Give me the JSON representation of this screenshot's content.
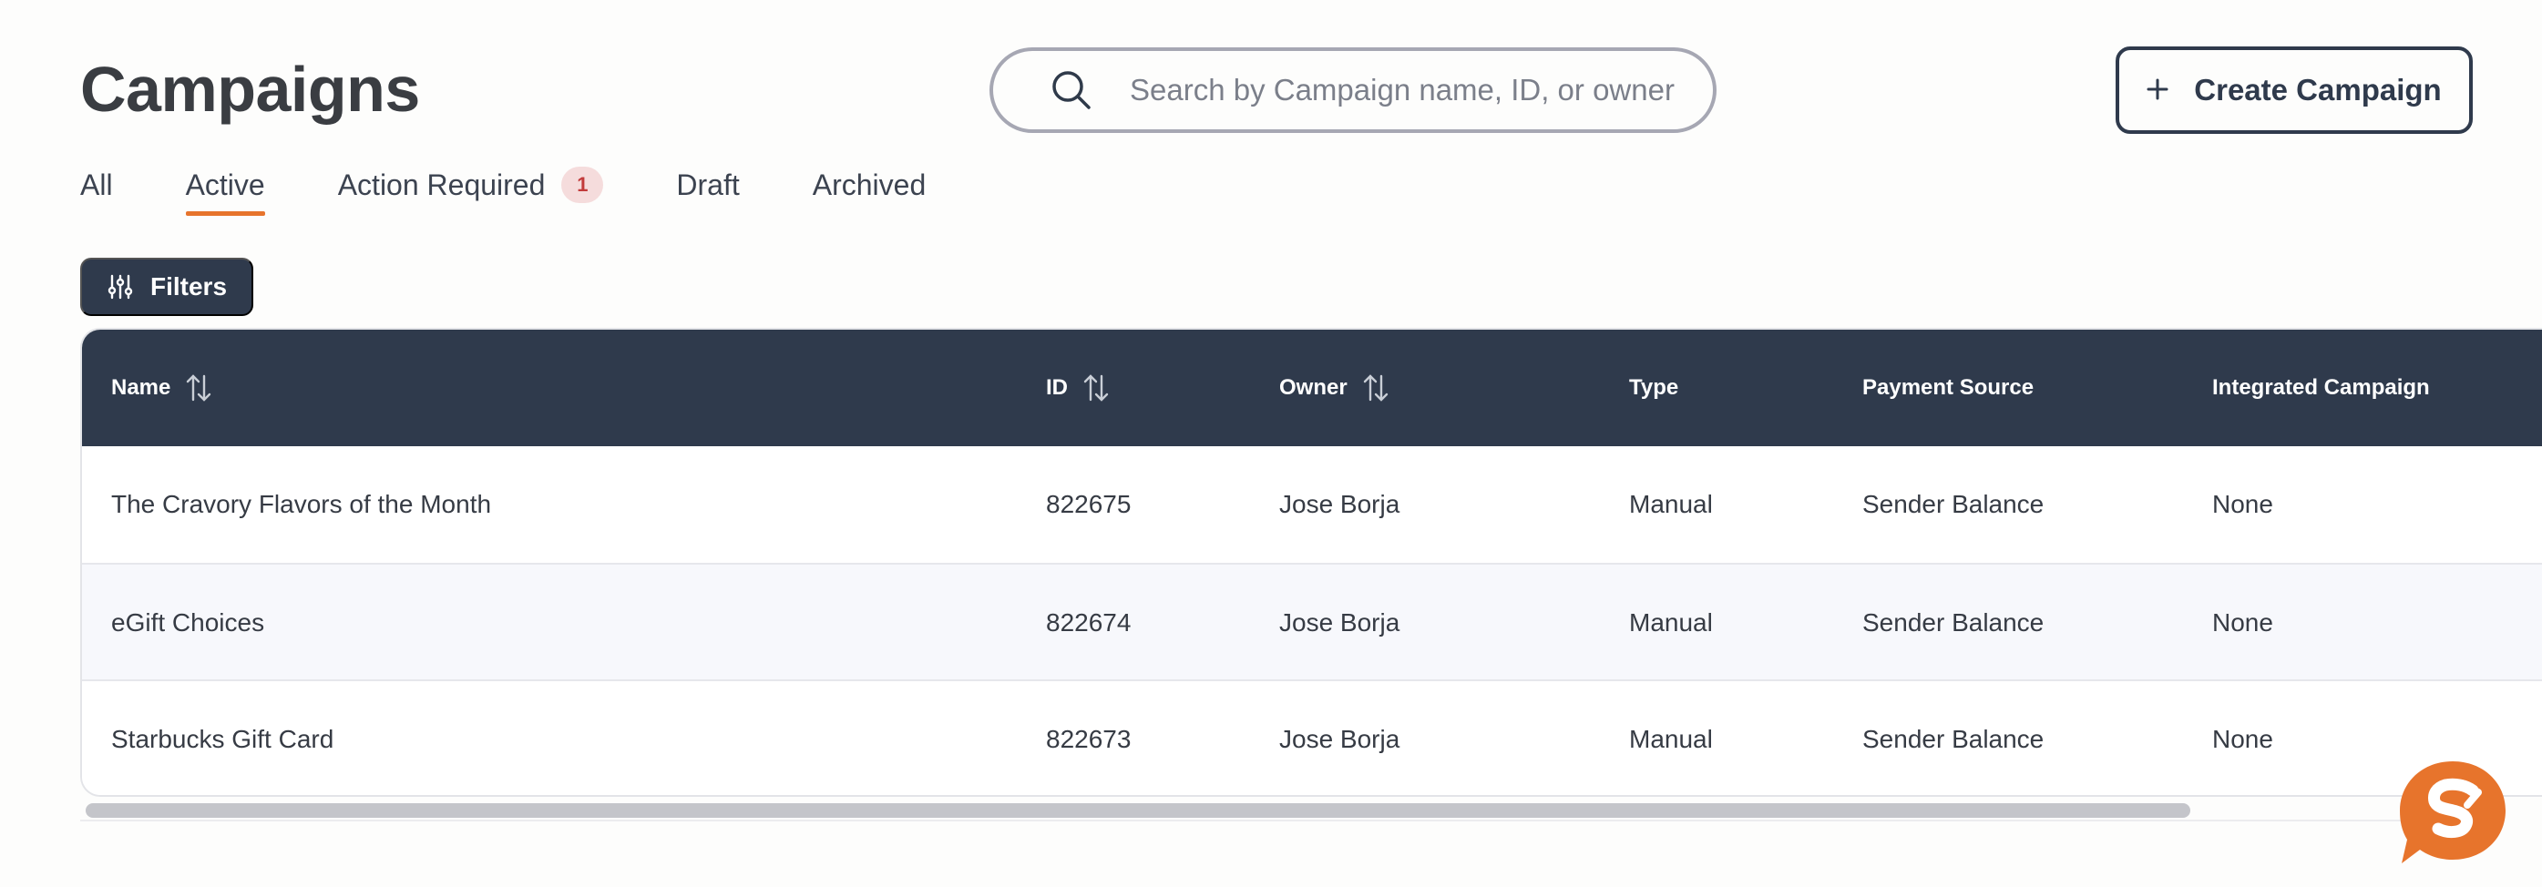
{
  "page": {
    "title": "Campaigns"
  },
  "search": {
    "placeholder": "Search by Campaign name, ID, or owner",
    "icon": "search-icon"
  },
  "create_button": {
    "label": "Create Campaign",
    "icon": "plus-icon"
  },
  "tabs": [
    {
      "label": "All",
      "active": false
    },
    {
      "label": "Active",
      "active": true
    },
    {
      "label": "Action Required",
      "active": false,
      "badge": "1"
    },
    {
      "label": "Draft",
      "active": false
    },
    {
      "label": "Archived",
      "active": false
    }
  ],
  "filters_button": {
    "label": "Filters",
    "icon": "sliders-icon"
  },
  "table": {
    "columns": [
      {
        "label": "Name",
        "sortable": true
      },
      {
        "label": "ID",
        "sortable": true
      },
      {
        "label": "Owner",
        "sortable": true
      },
      {
        "label": "Type",
        "sortable": false
      },
      {
        "label": "Payment Source",
        "sortable": false
      },
      {
        "label": "Integrated Campaign",
        "sortable": false
      }
    ],
    "rows": [
      {
        "name": "The Cravory Flavors of the Month",
        "id": "822675",
        "owner": "Jose Borja",
        "type": "Manual",
        "payment_source": "Sender Balance",
        "integrated": "None"
      },
      {
        "name": "eGift Choices",
        "id": "822674",
        "owner": "Jose Borja",
        "type": "Manual",
        "payment_source": "Sender Balance",
        "integrated": "None"
      },
      {
        "name": "Starbucks Gift Card",
        "id": "822673",
        "owner": "Jose Borja",
        "type": "Manual",
        "payment_source": "Sender Balance",
        "integrated": "None"
      }
    ]
  },
  "colors": {
    "header_bg": "#2f3a4c",
    "accent": "#e7742c",
    "badge_bg": "#f5dcdc",
    "badge_text": "#c23b3b"
  },
  "chat_widget": {
    "icon": "chat-logo-icon",
    "color": "#e7742c"
  }
}
